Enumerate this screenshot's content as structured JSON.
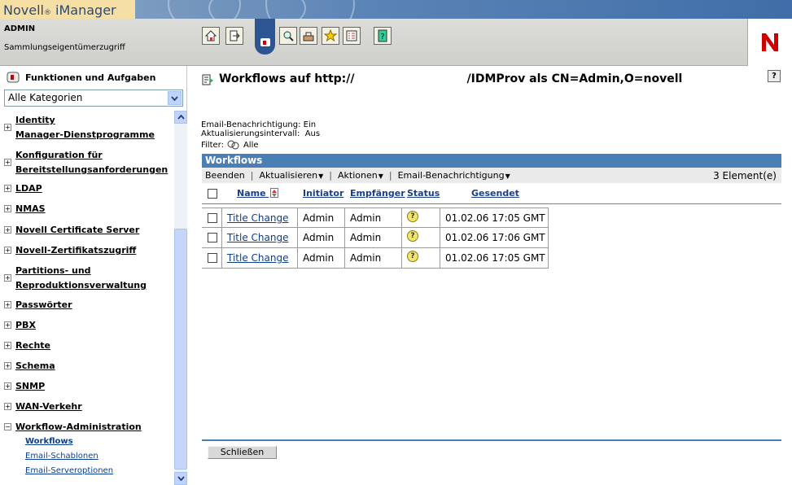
{
  "app": {
    "brand": "Novell",
    "reg": "®",
    "product": " iManager"
  },
  "user": {
    "name": "ADMIN",
    "role": "Sammlungseigentümerzugriff"
  },
  "toolbar": {
    "icons": [
      "home-icon",
      "exit-icon",
      "roles-tasks-icon",
      "view-objects-icon",
      "configure-icon",
      "favorites-icon",
      "preferences-icon",
      "help-icon"
    ]
  },
  "sidebar": {
    "header": "Funktionen und Aufgaben",
    "category_select": "Alle Kategorien",
    "items": [
      {
        "line1": "Identity",
        "line2": "Manager-Dienstprogramme"
      },
      {
        "line1": "Konfiguration für",
        "line2": "Bereitstellungsanforderungen"
      },
      {
        "line1": "LDAP"
      },
      {
        "line1": "NMAS"
      },
      {
        "line1": "Novell Certificate Server"
      },
      {
        "line1": "Novell-Zertifikatszugriff"
      },
      {
        "line1": "Partitions- und",
        "line2": "Reproduktionsverwaltung"
      },
      {
        "line1": "Passwörter"
      },
      {
        "line1": "PBX"
      },
      {
        "line1": "Rechte"
      },
      {
        "line1": "Schema"
      },
      {
        "line1": "SNMP"
      },
      {
        "line1": "WAN-Verkehr"
      },
      {
        "line1": "Workflow-Administration"
      }
    ],
    "subitems": [
      "Workflows",
      "Email-Schablonen",
      "Email-Serveroptionen"
    ]
  },
  "main": {
    "title_prefix": "Workflows auf http://",
    "title_suffix": "/IDMProv als CN=Admin,O=novell",
    "email_notification": "Email-Benachrichtigung: Ein",
    "refresh_interval_label": "Aktualisierungsintervall:",
    "refresh_interval_value": "Aus",
    "filter_label": "Filter:",
    "filter_value": "Alle",
    "table_title": "Workflows",
    "actions": [
      "Beenden",
      "Aktualisieren",
      "Aktionen",
      "Email-Benachrichtigung"
    ],
    "count": "3 Element(e)",
    "columns": [
      "Name",
      "Initiator",
      "Empfänger",
      "Status",
      "Gesendet"
    ],
    "rows": [
      {
        "name": "Title Change",
        "initiator": "Admin",
        "recipient": "Admin",
        "sent": "01.02.06 17:05 GMT"
      },
      {
        "name": "Title Change",
        "initiator": "Admin",
        "recipient": "Admin",
        "sent": "01.02.06 17:06 GMT"
      },
      {
        "name": "Title Change",
        "initiator": "Admin",
        "recipient": "Admin",
        "sent": "01.02.06 17:05 GMT"
      }
    ],
    "close_button": "Schließen",
    "help": "?"
  },
  "colors": {
    "brand_bg": "#f6dfa4",
    "blue_bar": "#4a7fb5",
    "link": "#0b3f8f",
    "novell_red": "#cc0000"
  }
}
